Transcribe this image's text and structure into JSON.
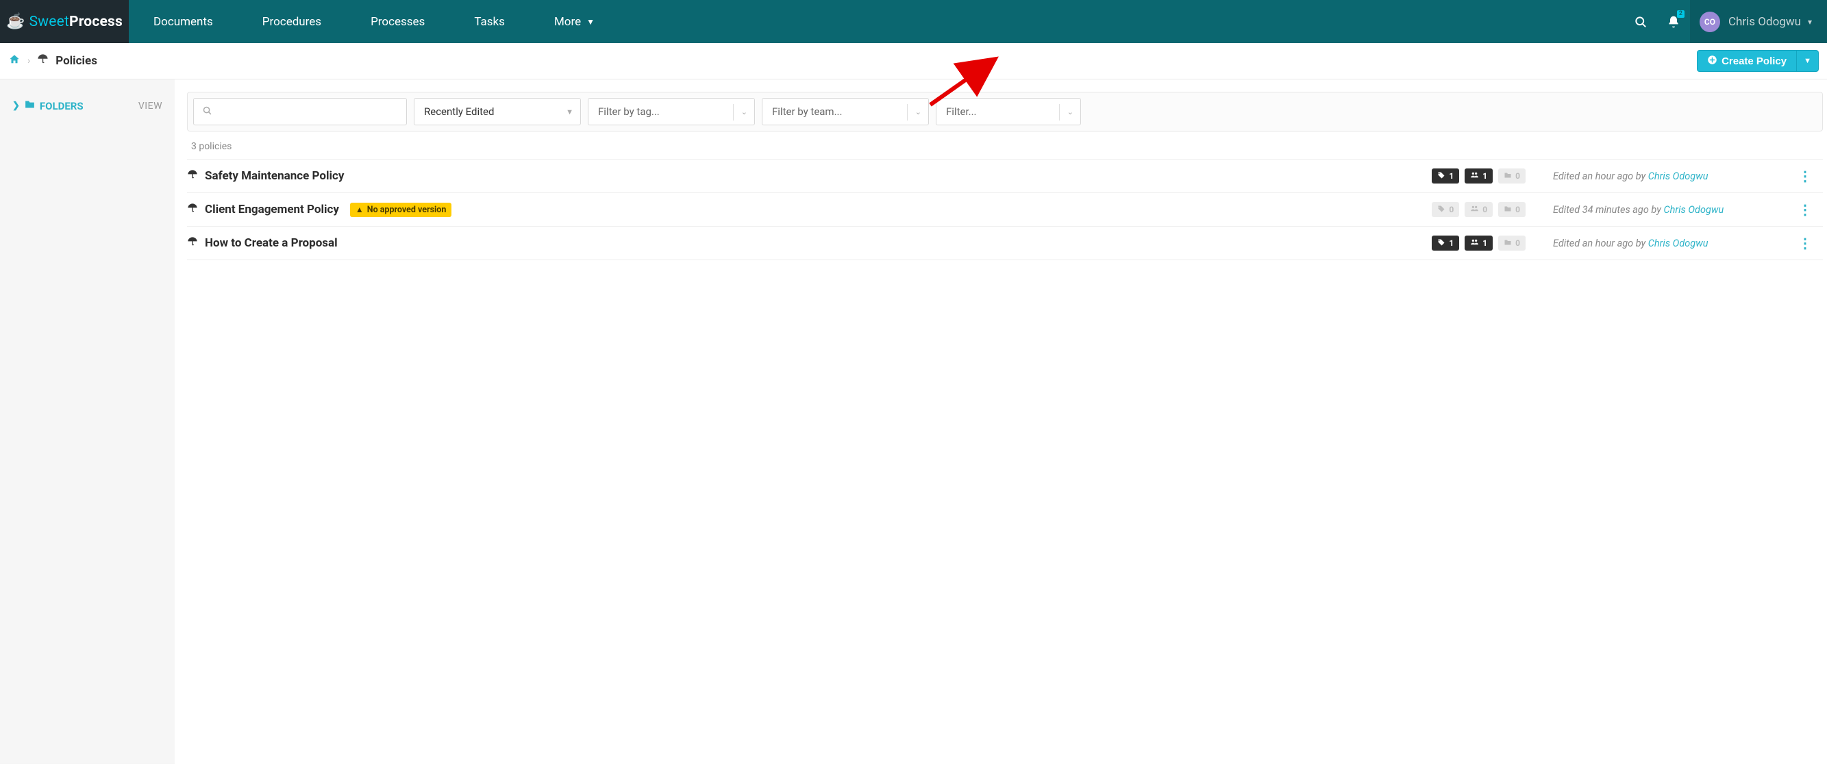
{
  "brand": {
    "left": "Sweet",
    "right": "Process"
  },
  "nav": {
    "items": [
      "Documents",
      "Procedures",
      "Processes",
      "Tasks"
    ],
    "more_label": "More"
  },
  "notifications": {
    "count": "2"
  },
  "user": {
    "initials": "CO",
    "name": "Chris Odogwu"
  },
  "breadcrumb": {
    "title": "Policies"
  },
  "actions": {
    "create_label": "Create Policy"
  },
  "sidebar": {
    "folders_label": "FOLDERS",
    "view_label": "VIEW"
  },
  "filters": {
    "recently_label": "Recently Edited",
    "tag_placeholder": "Filter by tag...",
    "team_placeholder": "Filter by team...",
    "last_placeholder": "Filter..."
  },
  "list": {
    "count_label": "3 policies",
    "rows": [
      {
        "title": "Safety Maintenance Policy",
        "warning": null,
        "tags": "1",
        "tags_active": true,
        "teams": "1",
        "teams_active": true,
        "folders": "0",
        "folders_active": false,
        "edited_prefix": "Edited an hour ago by ",
        "author": "Chris Odogwu"
      },
      {
        "title": "Client Engagement Policy",
        "warning": "No approved version",
        "tags": "0",
        "tags_active": false,
        "teams": "0",
        "teams_active": false,
        "folders": "0",
        "folders_active": false,
        "edited_prefix": "Edited 34 minutes ago by ",
        "author": "Chris Odogwu"
      },
      {
        "title": "How to Create a Proposal",
        "warning": null,
        "tags": "1",
        "tags_active": true,
        "teams": "1",
        "teams_active": true,
        "folders": "0",
        "folders_active": false,
        "edited_prefix": "Edited an hour ago by ",
        "author": "Chris Odogwu"
      }
    ]
  }
}
